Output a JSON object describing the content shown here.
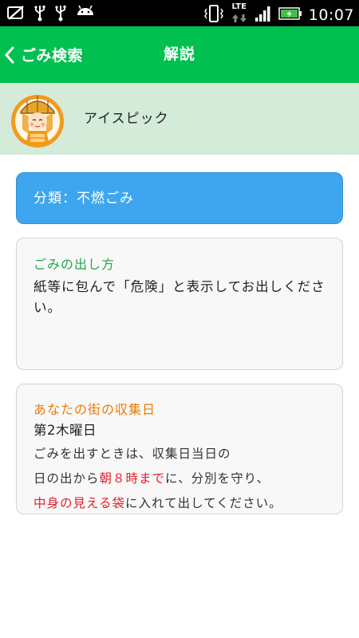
{
  "status_bar": {
    "time": "10:07",
    "network_label": "LTE",
    "left_icons": [
      "sync-off-icon",
      "usb-icon",
      "usb-icon",
      "android-icon"
    ],
    "right_icons": [
      "phone-vibrate-icon",
      "lte-icon",
      "signal-icon",
      "battery-charging-icon"
    ]
  },
  "app_bar": {
    "back_label": "ごみ検索",
    "title": "解説",
    "color": "#00c050"
  },
  "item": {
    "name": "アイスピック",
    "mascot_icon": "mascot-icon"
  },
  "category": {
    "text": "分類：不燃ごみ",
    "color": "#3ea6ee"
  },
  "how_to": {
    "title": "ごみの出し方",
    "body": "紙等に包んで「危険」と表示してお出しください。"
  },
  "collection_day": {
    "title": "あなたの街の収集日",
    "value": "第2木曜日",
    "note_1": "ごみを出すときは、収集日当日の",
    "note_2a": "日の出から",
    "note_2b": "朝８時まで",
    "note_2c": "に、分別を守り、",
    "note_3a": "中身の見える袋",
    "note_3b": "に入れて出してください。"
  }
}
